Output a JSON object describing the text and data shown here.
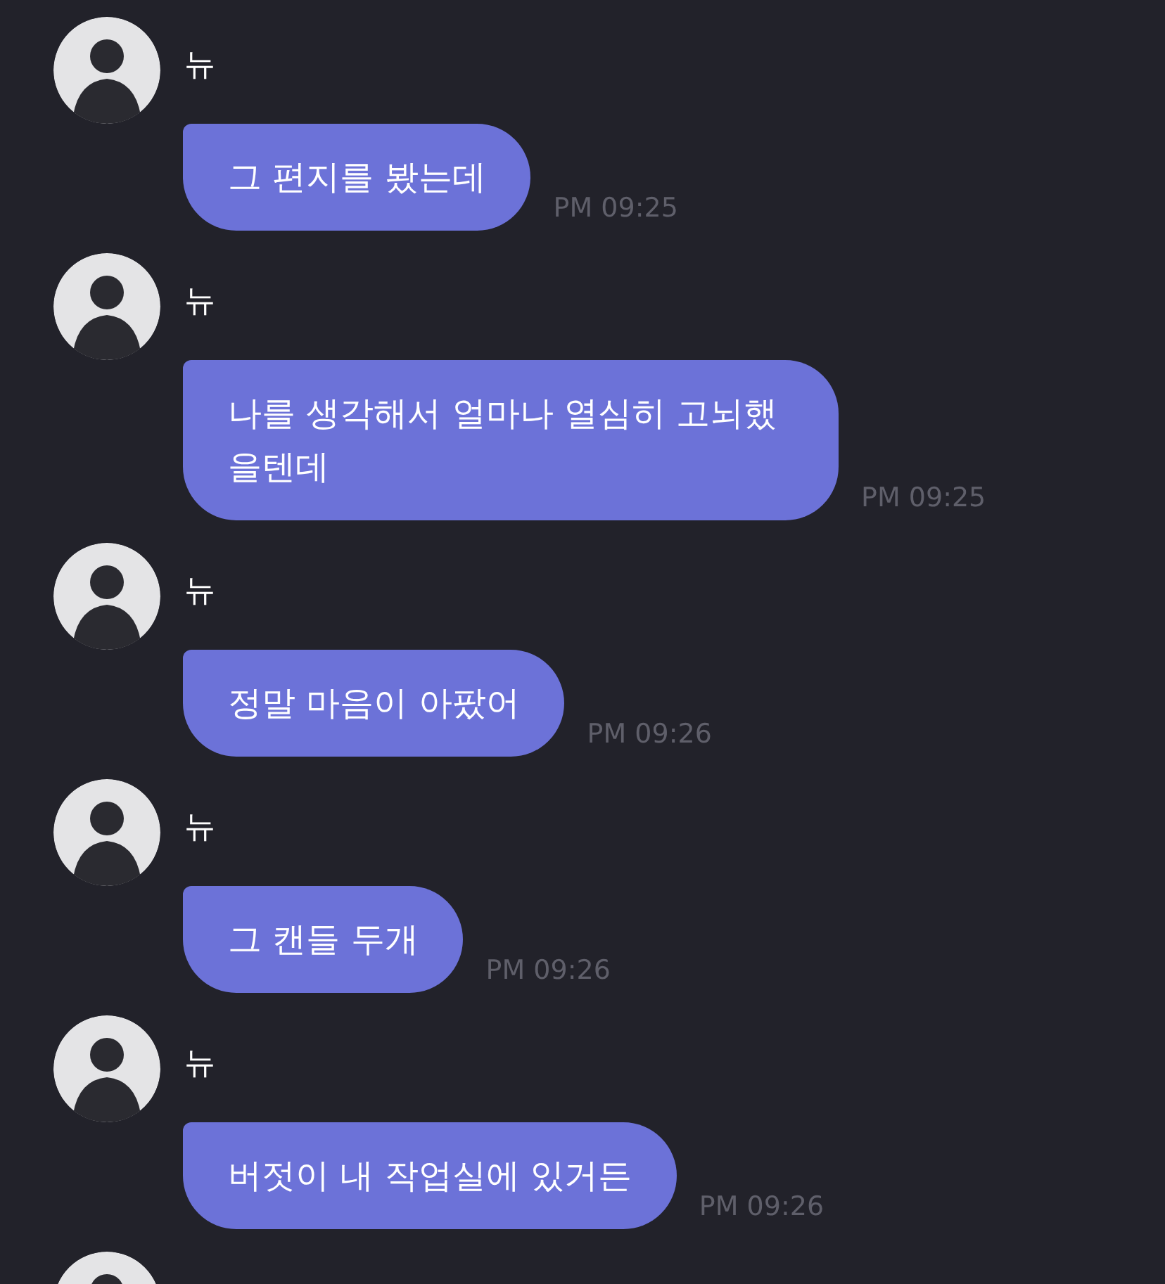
{
  "messages": [
    {
      "sender": "뉴",
      "text": "그 편지를 봤는데",
      "time": "PM 09:25"
    },
    {
      "sender": "뉴",
      "text": "나를 생각해서 얼마나 열심히 고뇌했을텐데",
      "time": "PM 09:25"
    },
    {
      "sender": "뉴",
      "text": "정말 마음이 아팠어",
      "time": "PM 09:26"
    },
    {
      "sender": "뉴",
      "text": "그 캔들 두개",
      "time": "PM 09:26"
    },
    {
      "sender": "뉴",
      "text": "버젓이 내 작업실에 있거든",
      "time": "PM 09:26"
    }
  ],
  "next_avatar_visible": true
}
